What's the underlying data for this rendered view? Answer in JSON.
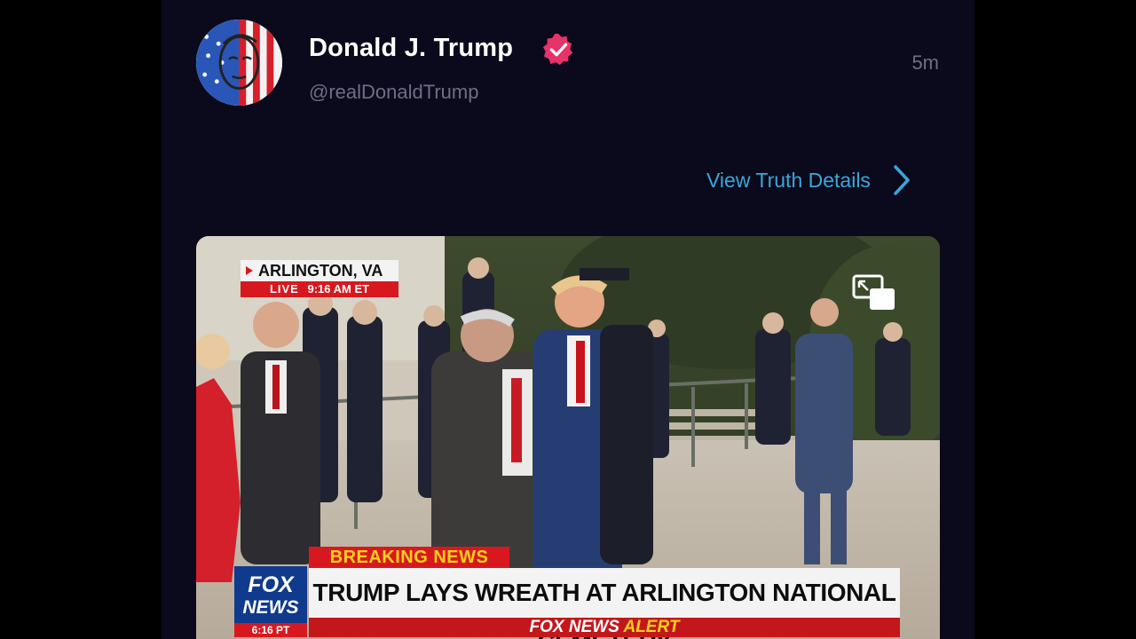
{
  "post": {
    "author_name": "Donald J. Trump",
    "handle": "@realDonaldTrump",
    "time": "5m",
    "view_details_label": "View Truth Details",
    "icons": {
      "avatar": "profile-avatar",
      "verified": "verified-badge-icon",
      "chevron": "chevron-right-icon",
      "pip": "picture-in-picture-icon"
    }
  },
  "media": {
    "location": "ARLINGTON, VA",
    "live_label": "LIVE",
    "live_time": "9:16 AM ET",
    "breaking": "BREAKING NEWS",
    "network_line1": "FOX",
    "network_line2": "NEWS",
    "network_time": "6:16 PT",
    "headline": "TRUMP LAYS WREATH AT ARLINGTON NATIONAL CEMETERY",
    "alert_part1": "FOX NEWS",
    "alert_part2": "ALERT"
  },
  "colors": {
    "background": "#0b0a1c",
    "accent_link": "#3aa7d8",
    "verified": "#e6336a",
    "fox_red": "#d7191f",
    "fox_blue": "#103a8c"
  }
}
